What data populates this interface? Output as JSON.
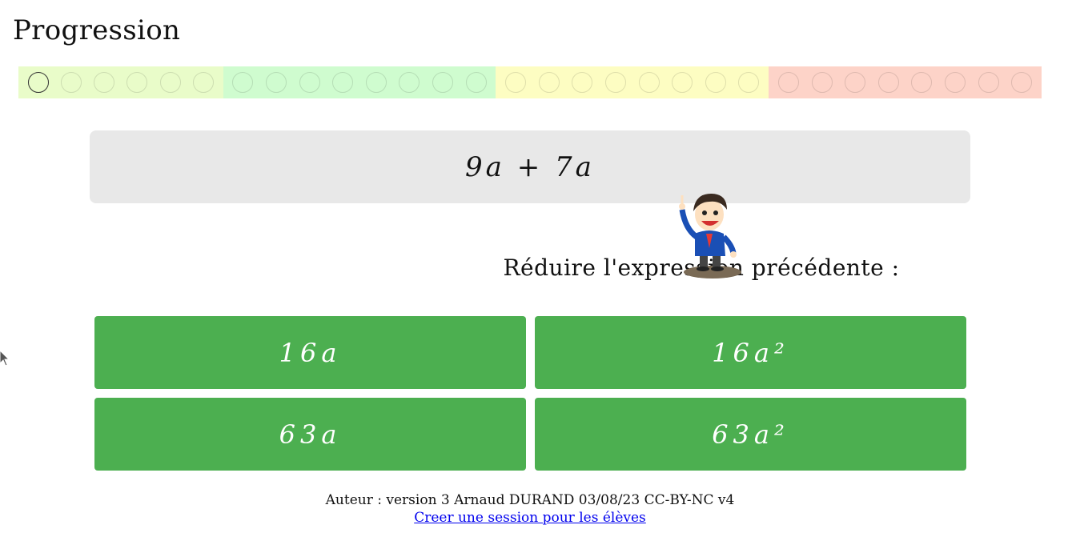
{
  "header": {
    "title": "Progression"
  },
  "progress": {
    "segments": [
      {
        "color": "#e9fcc9",
        "count": 6
      },
      {
        "color": "#cffccf",
        "count": 8
      },
      {
        "color": "#fdfdc2",
        "count": 8
      },
      {
        "color": "#fdd3c8",
        "count": 8
      }
    ],
    "current_index": 0
  },
  "question": {
    "expression": "9a + 7a",
    "instruction": "Réduire l'expression précédente :"
  },
  "answers": [
    {
      "label": "16a"
    },
    {
      "label": "16a²"
    },
    {
      "label": "63a"
    },
    {
      "label": "63a²"
    }
  ],
  "footer": {
    "author": "Auteur : version 3 Arnaud DURAND 03/08/23 CC-BY-NC v4",
    "link": "Creer une session pour les élèves"
  },
  "colors": {
    "answer_bg": "#4caf50",
    "expression_bg": "#e8e8e8"
  }
}
